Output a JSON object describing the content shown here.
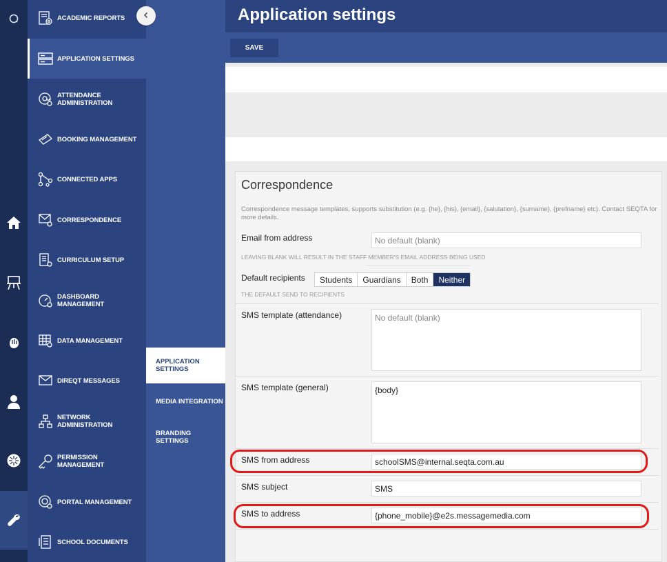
{
  "rail": {
    "items": [
      {
        "name": "search-icon"
      },
      {
        "name": "home-icon"
      },
      {
        "name": "classroom-icon"
      },
      {
        "name": "hand-icon"
      },
      {
        "name": "user-icon"
      },
      {
        "name": "burst-icon"
      },
      {
        "name": "wrench-icon"
      }
    ]
  },
  "menu": {
    "items": [
      {
        "label": "Academic reports",
        "icon": "academic-reports-icon"
      },
      {
        "label": "Application settings",
        "icon": "application-settings-icon"
      },
      {
        "label": "Attendance administration",
        "icon": "attendance-icon"
      },
      {
        "label": "Booking management",
        "icon": "booking-icon"
      },
      {
        "label": "Connected apps",
        "icon": "connected-apps-icon"
      },
      {
        "label": "Correspondence",
        "icon": "correspondence-icon"
      },
      {
        "label": "Curriculum setup",
        "icon": "curriculum-icon"
      },
      {
        "label": "Dashboard management",
        "icon": "dashboard-icon"
      },
      {
        "label": "Data management",
        "icon": "data-icon"
      },
      {
        "label": "DireqT messages",
        "icon": "messages-icon"
      },
      {
        "label": "Network administration",
        "icon": "network-icon"
      },
      {
        "label": "Permission management",
        "icon": "permission-icon"
      },
      {
        "label": "Portal management",
        "icon": "portal-icon"
      },
      {
        "label": "School documents",
        "icon": "documents-icon"
      }
    ]
  },
  "submenu": {
    "items": [
      {
        "label": "Application settings"
      },
      {
        "label": "Media integration"
      },
      {
        "label": "Branding settings"
      }
    ]
  },
  "header": {
    "title": "Application settings"
  },
  "toolbar": {
    "save_label": "SAVE"
  },
  "card": {
    "title": "Correspondence",
    "description": "Correspondence message templates, supports substitution (e.g. {he}, {his}, {email}, {salutation}, {surname}, {prefname} etc). Contact SEQTA for more details.",
    "email_from": {
      "label": "Email from address",
      "placeholder": "No default (blank)",
      "hint": "Leaving blank will result in the staff member's email address being used"
    },
    "default_recipients": {
      "label": "Default recipients",
      "options": [
        "Students",
        "Guardians",
        "Both",
        "Neither"
      ],
      "selected": "Neither",
      "hint": "The default send to recipients"
    },
    "sms_template_attendance": {
      "label": "SMS template (attendance)",
      "placeholder": "No default (blank)"
    },
    "sms_template_general": {
      "label": "SMS template (general)",
      "value": "{body}"
    },
    "sms_from": {
      "label": "SMS from address",
      "value": "schoolSMS@internal.seqta.com.au"
    },
    "sms_subject": {
      "label": "SMS subject",
      "value": "SMS"
    },
    "sms_to": {
      "label": "SMS to address",
      "value": "{phone_mobile}@e2s.messagemedia.com"
    }
  },
  "annotations": {
    "highlight_color": "#e01818"
  },
  "colors": {
    "rail": "#1b2d55",
    "menu": "#2b4480",
    "submenu": "#3a5595",
    "selected": "#1e3160"
  }
}
